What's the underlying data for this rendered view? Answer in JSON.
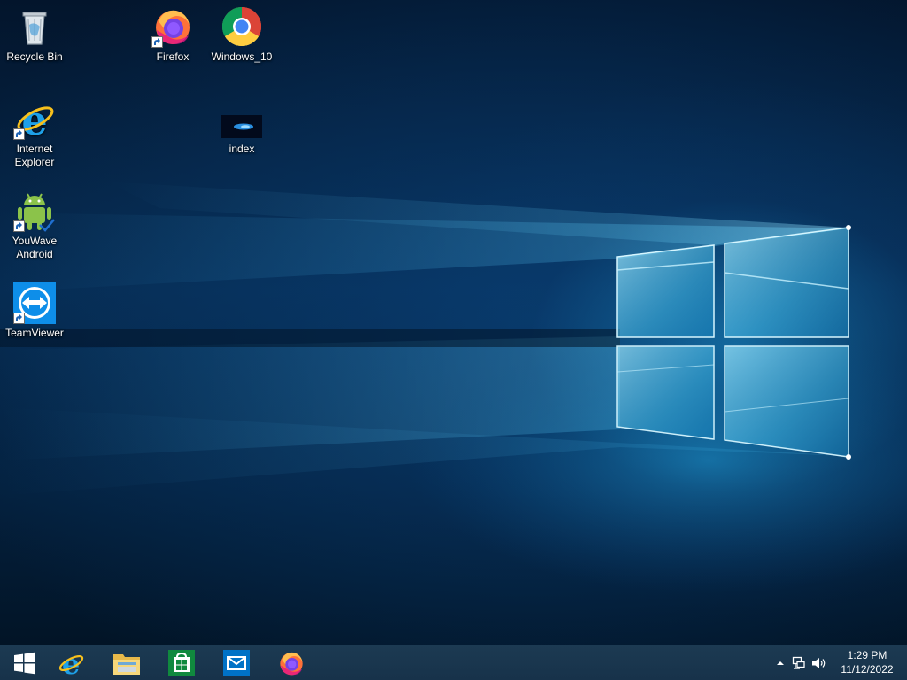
{
  "desktop": {
    "icons": [
      {
        "label": "Recycle Bin",
        "icon": "recycle-bin-icon"
      },
      {
        "label": "Firefox",
        "icon": "firefox-icon",
        "shortcut": true
      },
      {
        "label": "Windows_10",
        "icon": "chrome-icon"
      },
      {
        "label": "Internet Explorer",
        "icon": "internet-explorer-icon",
        "shortcut": true
      },
      {
        "label": "index",
        "icon": "image-file-icon"
      },
      {
        "label": "YouWave Android",
        "icon": "android-icon",
        "shortcut": true
      },
      {
        "label": "TeamViewer",
        "icon": "teamviewer-icon",
        "shortcut": true
      }
    ]
  },
  "taskbar": {
    "pinned": [
      {
        "name": "Start",
        "icon": "windows-logo-icon"
      },
      {
        "name": "Internet Explorer",
        "icon": "internet-explorer-icon"
      },
      {
        "name": "File Explorer",
        "icon": "file-explorer-icon"
      },
      {
        "name": "Store",
        "icon": "store-icon"
      },
      {
        "name": "Mail",
        "icon": "mail-icon"
      },
      {
        "name": "Firefox",
        "icon": "firefox-icon"
      }
    ],
    "tray": {
      "icons": [
        "show-hidden-icons-arrow-icon",
        "network-icon",
        "volume-icon"
      ],
      "time": "1:29 PM",
      "date": "11/12/2022"
    }
  },
  "colors": {
    "taskbar": "#17324a",
    "wallpaper_dark": "#03152c",
    "wallpaper_glow": "#1e96d2"
  }
}
